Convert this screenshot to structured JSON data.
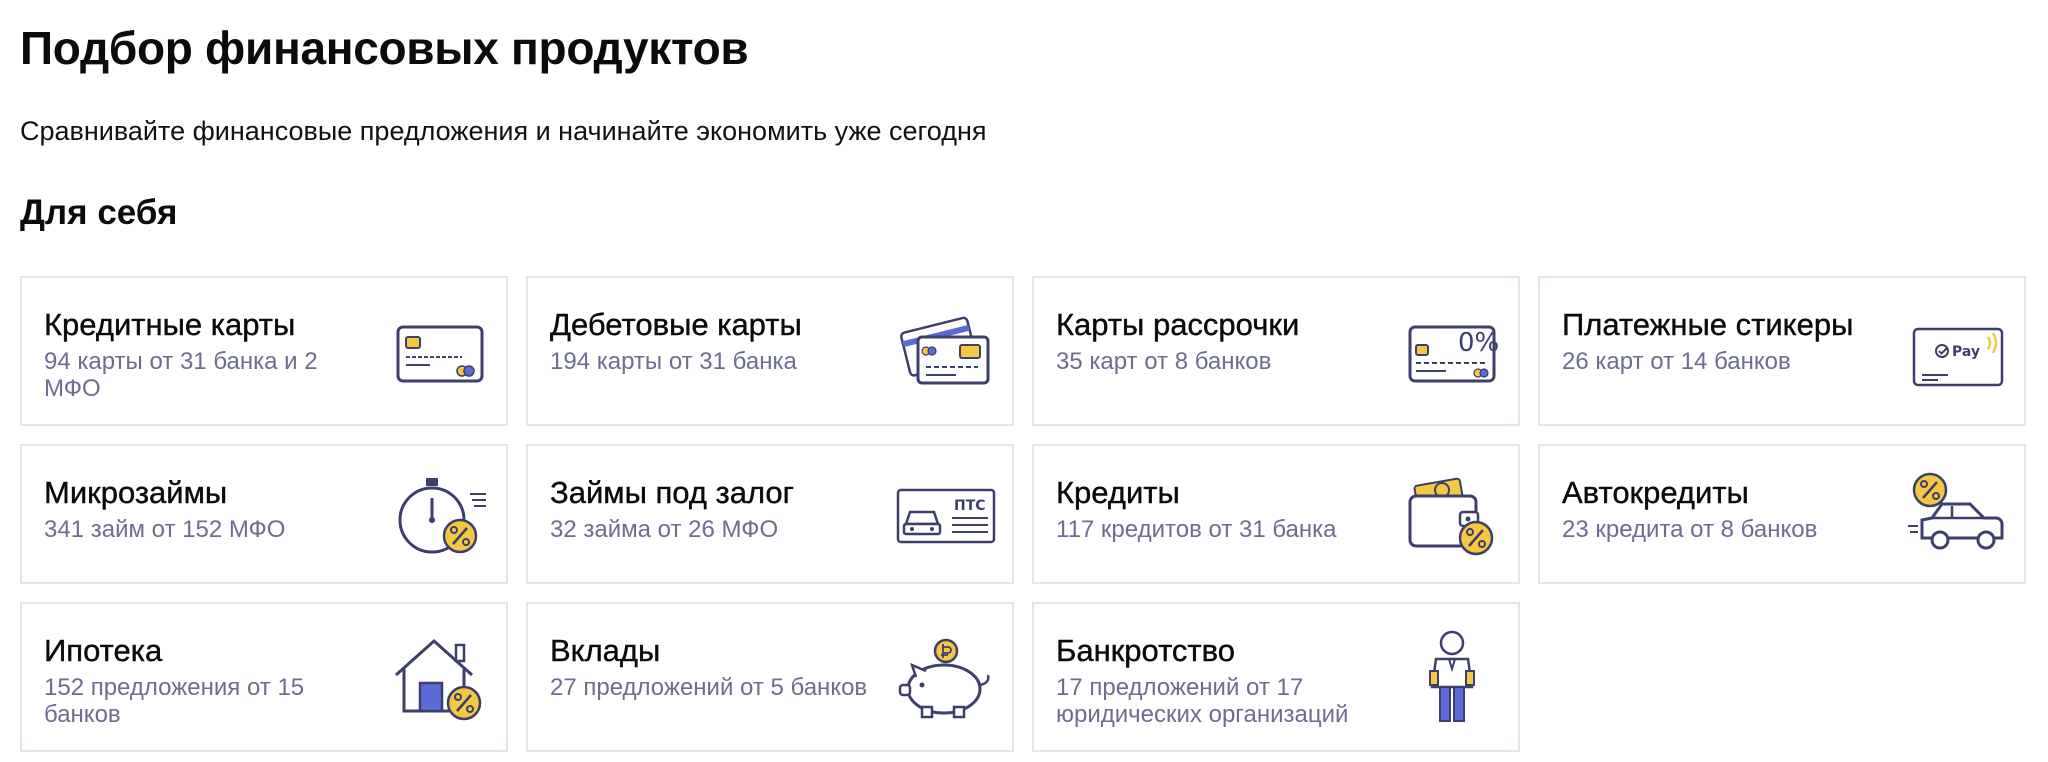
{
  "header": {
    "title": "Подбор финансовых продуктов",
    "subtitle": "Сравнивайте финансовые предложения и начинайте экономить уже сегодня"
  },
  "section": {
    "title": "Для себя"
  },
  "cards": [
    {
      "title": "Кредитные карты",
      "desc": "94 карты от 31 банка и 2 МФО",
      "icon": "credit-card-icon"
    },
    {
      "title": "Дебетовые карты",
      "desc": "194 карты от 31 банка",
      "icon": "debit-cards-icon"
    },
    {
      "title": "Карты рассрочки",
      "desc": "35 карт от 8 банков",
      "icon": "installment-card-icon",
      "icon_text": "0%"
    },
    {
      "title": "Платежные стикеры",
      "desc": "26 карт от 14 банков",
      "icon": "payment-sticker-icon",
      "icon_text": "Pay"
    },
    {
      "title": "Микрозаймы",
      "desc": "341 займ от 152 МФО",
      "icon": "stopwatch-percent-icon"
    },
    {
      "title": "Займы под залог",
      "desc": "32 займа от 26 МФО",
      "icon": "vehicle-passport-icon",
      "icon_text": "ПТС"
    },
    {
      "title": "Кредиты",
      "desc": "117 кредитов от 31 банка",
      "icon": "wallet-percent-icon"
    },
    {
      "title": "Автокредиты",
      "desc": "23 кредита от 8 банков",
      "icon": "car-percent-icon"
    },
    {
      "title": "Ипотека",
      "desc": "152 предложения от 15 банков",
      "icon": "house-percent-icon"
    },
    {
      "title": "Вклады",
      "desc": "27 предложений от 5 банков",
      "icon": "piggy-bank-icon"
    },
    {
      "title": "Банкротство",
      "desc": "17 предложений от 17 юридических организаций",
      "icon": "bankrupt-person-icon"
    }
  ],
  "colors": {
    "accent_yellow": "#f5c843",
    "icon_stroke": "#3d3f6b",
    "icon_blue": "#5b6ad6",
    "card_border": "#e2e3f0",
    "desc_text": "#6b6e8e"
  }
}
